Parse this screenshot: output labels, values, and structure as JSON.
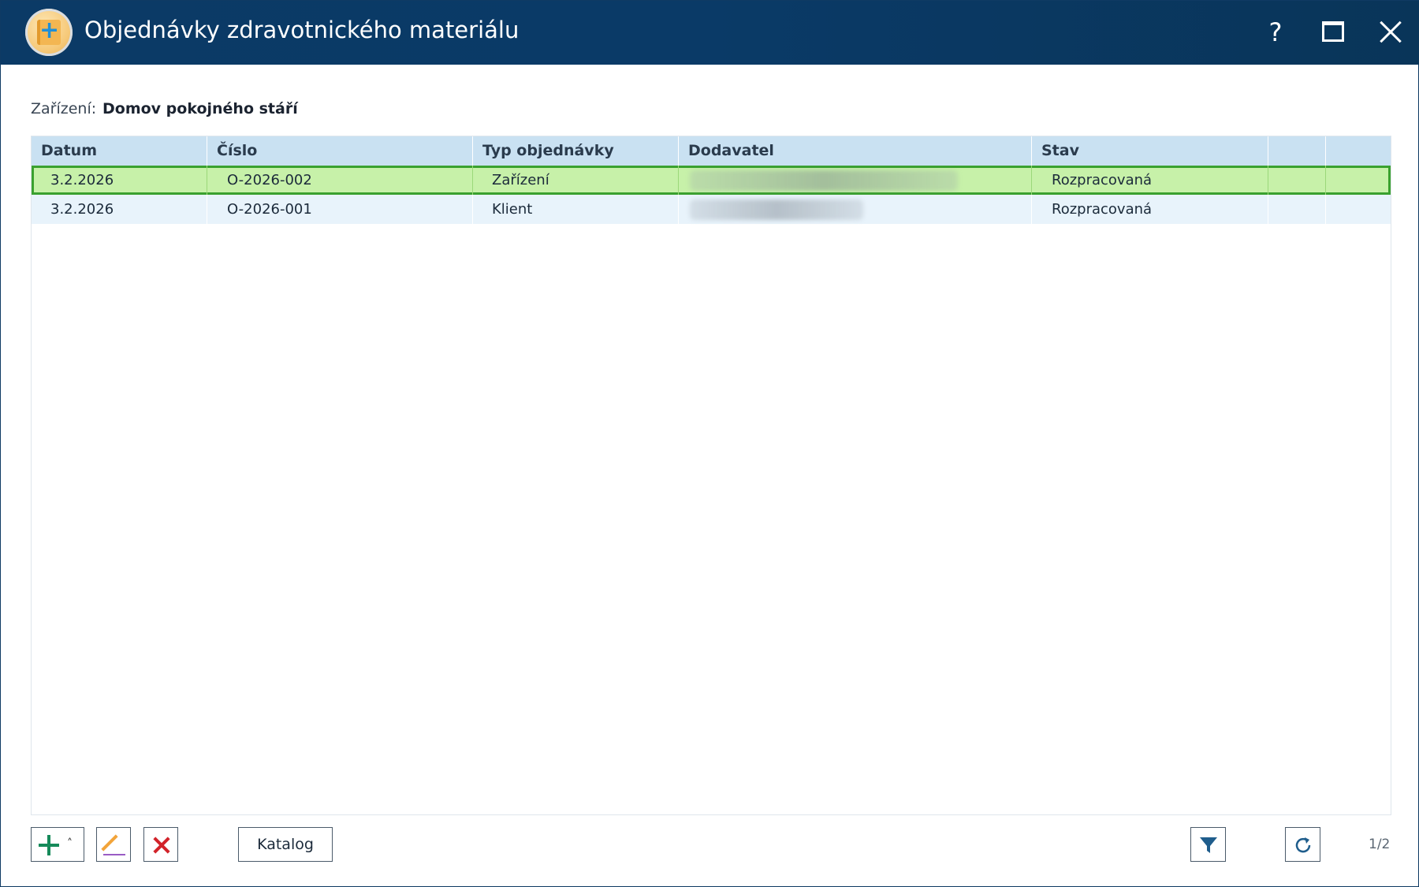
{
  "window": {
    "title": "Objednávky zdravotnického materiálu",
    "help_label": "?"
  },
  "facility": {
    "label": "Zařízení:",
    "value": "Domov pokojného stáří"
  },
  "table": {
    "columns": [
      "Datum",
      "Číslo",
      "Typ objednávky",
      "Dodavatel",
      "Stav",
      "",
      ""
    ],
    "rows": [
      {
        "datum": "3.2.2026",
        "cislo": "O-2026-002",
        "typ": "Zařízení",
        "dodavatel": "",
        "stav": "Rozpracovaná",
        "selected": true
      },
      {
        "datum": "3.2.2026",
        "cislo": "O-2026-001",
        "typ": "Klient",
        "dodavatel": "",
        "stav": "Rozpracovaná",
        "selected": false
      }
    ]
  },
  "toolbar": {
    "add_icon": "plus-icon",
    "edit_icon": "pencil-icon",
    "delete_icon": "delete-x-icon",
    "katalog_label": "Katalog",
    "filter_icon": "filter-icon",
    "refresh_icon": "refresh-icon",
    "pager": "1/2"
  },
  "colors": {
    "titlebar": "#0b3a66",
    "header": "#c9e1f2",
    "selected_row": "#c7f1a9",
    "selected_border": "#3aa12f",
    "alt_row": "#e8f3fb"
  }
}
